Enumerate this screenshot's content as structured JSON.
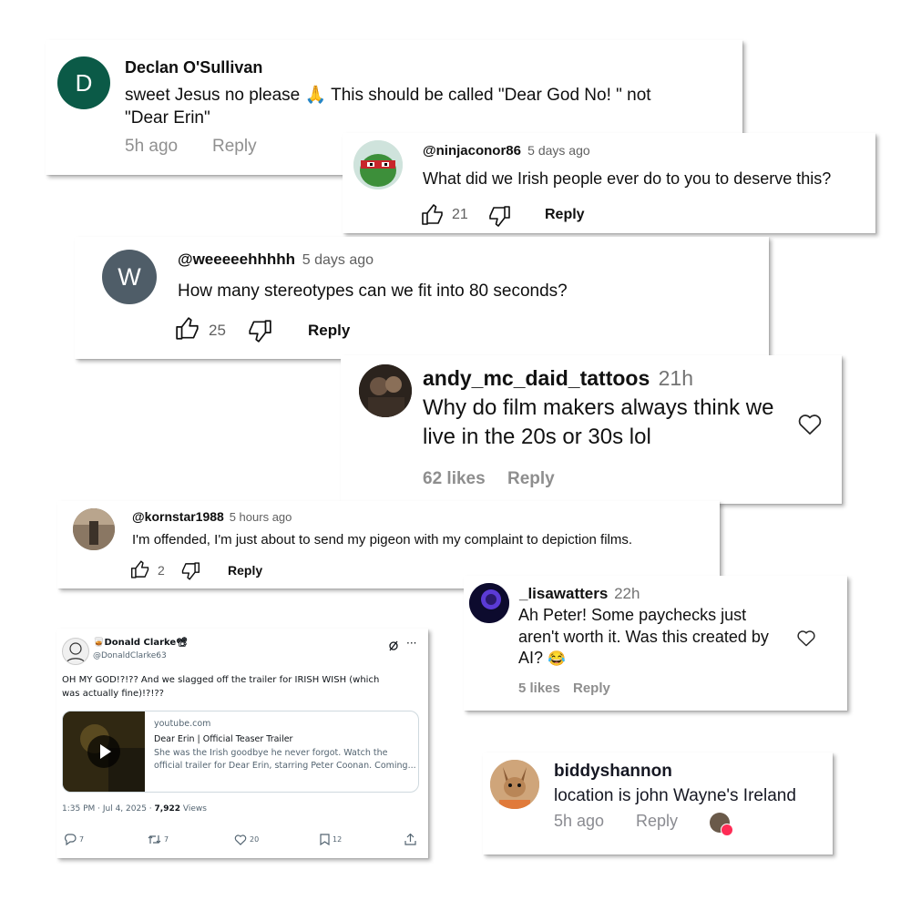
{
  "colors": {
    "declan_avatar": "#0b5a47",
    "weee_avatar": "#4f5d68",
    "muted": "#606060",
    "text": "#0f0f0f"
  },
  "c1": {
    "avatar_letter": "D",
    "author": "Declan O'Sullivan",
    "text_line1": "sweet Jesus no please",
    "emoji": "🙏",
    "text_line1b": "This should be called \"Dear God No! \" not",
    "text_line2": "\"Dear Erin\"",
    "time": "5h ago",
    "reply": "Reply"
  },
  "c2": {
    "author": "@ninjaconor86",
    "time": "5 days ago",
    "text": "What did we Irish people ever do to you to deserve this?",
    "likes": "21",
    "reply": "Reply"
  },
  "c3": {
    "avatar_letter": "W",
    "author": "@weeeeehhhhh",
    "time": "5 days ago",
    "text": "How many stereotypes can we fit into 80 seconds?",
    "likes": "25",
    "reply": "Reply"
  },
  "c4": {
    "author": "andy_mc_daid_tattoos",
    "time": "21h",
    "text_line1": "Why do film makers always think we",
    "text_line2": "live in the 20s or 30s lol",
    "likes": "62 likes",
    "reply": "Reply"
  },
  "c5": {
    "author": "@kornstar1988",
    "time": "5 hours ago",
    "text": "I'm offended, I'm just about to send my pigeon with my complaint to depiction films.",
    "likes": "2",
    "reply": "Reply"
  },
  "c6": {
    "author": "_lisawatters",
    "time": "22h",
    "text_line1": "Ah Peter! Some paychecks just",
    "text_line2": "aren't worth it. Was this created by",
    "text_line3": "AI?",
    "emoji": "😂",
    "likes": "5 likes",
    "reply": "Reply"
  },
  "tweet": {
    "name_prefix": "🥃",
    "name": "Donald Clarke",
    "name_suffix": "📽",
    "handle": "@DonaldClarke63",
    "text_line1": "OH MY GOD!?!?? And we slagged off the trailer for IRISH WISH (which",
    "text_line2": "was actually fine)!?!??",
    "link_domain": "youtube.com",
    "link_title": "Dear Erin | Official Teaser Trailer",
    "link_desc1": "She was the Irish goodbye he never forgot. Watch the",
    "link_desc2": "official trailer for Dear Erin, starring Peter Coonan. Coming...",
    "time": "1:35 PM · Jul 4, 2025 ·",
    "views_count": "7,922",
    "views_label": "Views",
    "replies": "7",
    "retweets": "7",
    "likes": "20",
    "bookmarks": "12"
  },
  "c7": {
    "author": "biddyshannon",
    "text": "location is john Wayne's Ireland",
    "time": "5h ago",
    "reply": "Reply"
  }
}
